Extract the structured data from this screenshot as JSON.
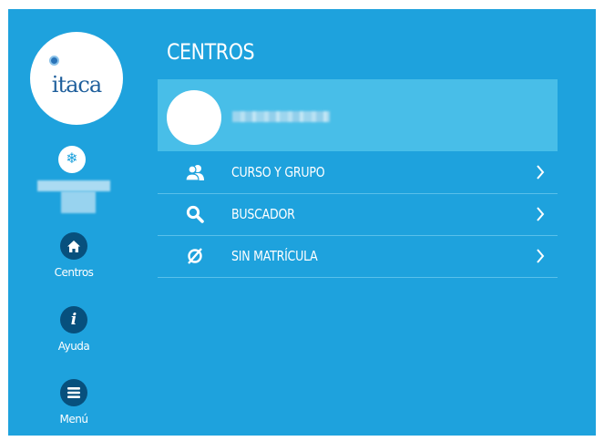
{
  "logo": {
    "text": "itaca"
  },
  "sidebar": {
    "user_icon": "snowflake-icon",
    "items": [
      {
        "label": "Centros",
        "icon": "home-icon"
      },
      {
        "label": "Ayuda",
        "icon": "info-icon"
      },
      {
        "label": "Menú",
        "icon": "menu-icon"
      }
    ]
  },
  "main": {
    "title": "CENTROS",
    "menu": [
      {
        "label": "CURSO Y GRUPO",
        "icon": "users-icon"
      },
      {
        "label": "BUSCADOR",
        "icon": "search-icon"
      },
      {
        "label": "SIN MATRÍCULA",
        "icon": "empty-set-icon"
      }
    ]
  },
  "colors": {
    "background": "#1ea2dd",
    "card": "#48bee8",
    "sidebar_button": "#07507d",
    "text": "#ffffff"
  }
}
